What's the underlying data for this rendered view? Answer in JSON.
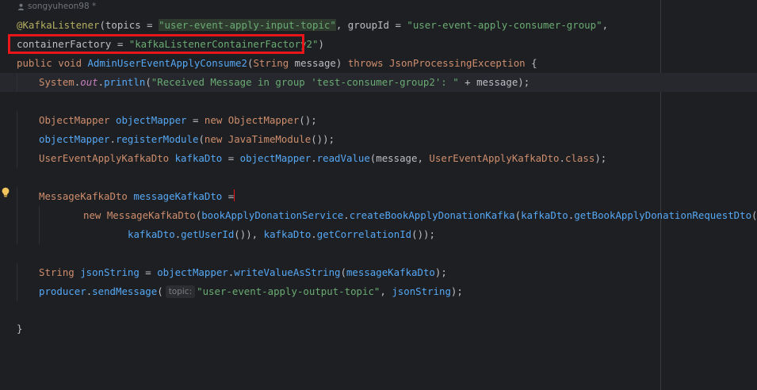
{
  "header": {
    "author": "songyuheon98 *"
  },
  "code": {
    "l1": {
      "ann": "@KafkaListener",
      "p1": "(",
      "a1": "topics",
      "p2": " = ",
      "s1": "\"user-event-apply-input-topic\"",
      "p3": ", ",
      "a2": "groupId",
      "p4": " = ",
      "s2": "\"user-event-apply-consumer-group\"",
      "p5": ","
    },
    "l2": {
      "a": "containerFactory",
      "p": " = ",
      "s": "\"kafkaListenerContainerFactory2\"",
      "e": ")"
    },
    "l3": {
      "k1": "public",
      "k2": "void",
      "name": "AdminUserEventApplyConsume2",
      "p1": "(",
      "t": "String",
      "param": " message",
      "p2": ") ",
      "k3": "throws",
      "ex": "JsonProcessingException",
      "p3": " {"
    },
    "l4": {
      "c": "System",
      "d1": ".",
      "f": "out",
      "d2": ".",
      "m": "println",
      "p1": "(",
      "s": "\"Received Message in group 'test-consumer-group2': \"",
      "p2": " + message);"
    },
    "l5": {
      "t": "ObjectMapper",
      "v": " objectMapper",
      "p1": " = ",
      "k": "new",
      "c": " ObjectMapper",
      "p2": "();"
    },
    "l6": {
      "v": "objectMapper",
      "d": ".",
      "m": "registerModule",
      "p1": "(",
      "k": "new",
      "c": " JavaTimeModule",
      "p2": "());"
    },
    "l7": {
      "t": "UserEventApplyKafkaDto",
      "v": " kafkaDto",
      "p1": " = ",
      "v2": "objectMapper",
      "d": ".",
      "m": "readValue",
      "p2": "(message, ",
      "c": "UserEventApplyKafkaDto",
      "d2": ".",
      "k": "class",
      "p3": ");"
    },
    "l8": {
      "t": "MessageKafkaDto",
      "v": " messageKafkaDto",
      "p": " ="
    },
    "l9": {
      "k": "new",
      "c": " MessageKafkaDto",
      "p1": "(",
      "v": "bookApplyDonationService",
      "d": ".",
      "m": "createBookApplyDonationKafka",
      "p2": "(",
      "v2": "kafkaDto",
      "d2": ".",
      "m2": "getBookApplyDonationRequestDto",
      "p3": "(),"
    },
    "l10": {
      "v": "kafkaDto",
      "d": ".",
      "m": "getUserId",
      "p1": "()), ",
      "v2": "kafkaDto",
      "d2": ".",
      "m2": "getCorrelationId",
      "p2": "());"
    },
    "l11": {
      "t": "String",
      "v": " jsonString",
      "p1": " = ",
      "v2": "objectMapper",
      "d": ".",
      "m": "writeValueAsString",
      "p2": "(",
      "v3": "messageKafkaDto",
      "p3": ");"
    },
    "l12": {
      "v": "producer",
      "d": ".",
      "m": "sendMessage",
      "p1": "(",
      "hint": "topic:",
      "s": "\"user-event-apply-output-topic\"",
      "p2": ", ",
      "v2": "jsonString",
      "p3": ");"
    },
    "l13": {
      "b": "}"
    }
  },
  "colors": {
    "background": "#1e1f22",
    "keyword": "#cf8e6d",
    "string": "#6aab73",
    "annotation": "#b3ae60",
    "method": "#56a8f5",
    "highlight_box": "#e8161b"
  },
  "icons": {
    "author": "person-icon",
    "bulb": "lightbulb-icon"
  }
}
